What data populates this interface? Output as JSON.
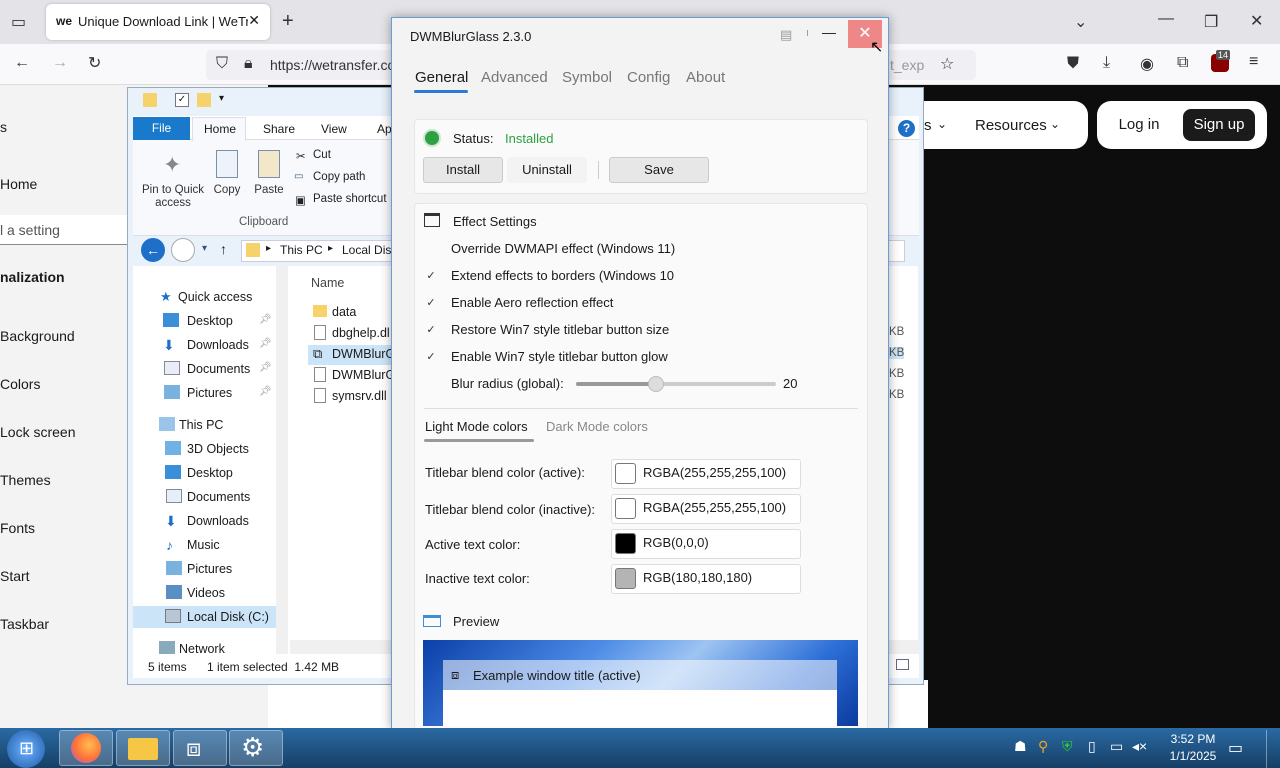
{
  "browser": {
    "tab_title": "Unique Download Link | WeTransfer",
    "tab_favicon": "we",
    "url": "https://wetransfer.com",
    "url_suffix": "t_exp",
    "extension_badge": "14"
  },
  "website": {
    "nav_resources": "Resources",
    "nav_other": "s",
    "login": "Log in",
    "signup": "Sign up"
  },
  "settings": {
    "items": [
      "s",
      "Home",
      "l a setting",
      "nalization",
      "Background",
      "Colors",
      "Lock screen",
      "Themes",
      "Fonts",
      "Start",
      "Taskbar"
    ]
  },
  "explorer": {
    "tabs": [
      "File",
      "Home",
      "Share",
      "View",
      "Ap"
    ],
    "pin_label": "Pin to Quick access",
    "copy_label": "Copy",
    "paste_label": "Paste",
    "cut_label": "Cut",
    "copy_path_label": "Copy path",
    "paste_shortcut_label": "Paste shortcut",
    "group_clipboard": "Clipboard",
    "breadcrumb": [
      "This PC",
      "Local Dis"
    ],
    "column_name": "Name",
    "files": [
      "data",
      "dbghelp.dl",
      "DWMBlurG",
      "DWMBlurG",
      "symsrv.dll"
    ],
    "sizes": [
      "KB",
      "KB",
      "KB",
      "KB"
    ],
    "nav": {
      "quick_access": "Quick access",
      "quick_items": [
        "Desktop",
        "Downloads",
        "Documents",
        "Pictures"
      ],
      "this_pc": "This PC",
      "pc_items": [
        "3D Objects",
        "Desktop",
        "Documents",
        "Downloads",
        "Music",
        "Pictures",
        "Videos",
        "Local Disk (C:)"
      ],
      "network": "Network"
    },
    "status_items": "5 items",
    "status_selected": "1 item selected  1.42 MB"
  },
  "dwm": {
    "title": "DWMBlurGlass 2.3.0",
    "tabs": [
      "General",
      "Advanced",
      "Symbol",
      "Config",
      "About"
    ],
    "status_label": "Status:",
    "status_value": "Installed",
    "install": "Install",
    "uninstall": "Uninstall",
    "save": "Save",
    "effect_settings": "Effect Settings",
    "options": [
      {
        "label": "Override DWMAPI effect (Windows 11)",
        "checked": false
      },
      {
        "label": "Extend effects to borders (Windows 10",
        "checked": true
      },
      {
        "label": "Enable Aero reflection effect",
        "checked": true
      },
      {
        "label": "Restore Win7 style titlebar button size",
        "checked": true
      },
      {
        "label": "Enable Win7 style titlebar button glow",
        "checked": true
      }
    ],
    "blur_label": "Blur radius (global):",
    "blur_value": "20",
    "blur_level": 0.4,
    "color_tabs": [
      "Light Mode colors",
      "Dark Mode colors"
    ],
    "colors": [
      {
        "label": "Titlebar blend color (active):",
        "value": "RGBA(255,255,255,100)",
        "swatch": "#ffffff"
      },
      {
        "label": "Titlebar blend color (inactive):",
        "value": "RGBA(255,255,255,100)",
        "swatch": "#ffffff"
      },
      {
        "label": "Active text color:",
        "value": "RGB(0,0,0)",
        "swatch": "#000000"
      },
      {
        "label": "Inactive text color:",
        "value": "RGB(180,180,180)",
        "swatch": "#b4b4b4"
      }
    ],
    "preview_label": "Preview",
    "preview_window_title": "Example window title (active)",
    "accent": "#2a7bd1",
    "status_color": "#2ea043"
  },
  "taskbar": {
    "time": "3:52 PM",
    "date": "1/1/2025"
  }
}
